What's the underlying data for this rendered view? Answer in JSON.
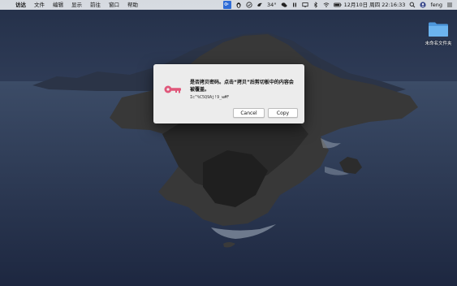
{
  "menubar": {
    "apple_label": "",
    "items": [
      "访达",
      "文件",
      "编辑",
      "显示",
      "前往",
      "窗口",
      "帮助"
    ],
    "status": {
      "temperature": "34°",
      "datetime": "12月10日 周四  22:16:33",
      "user": "feng"
    }
  },
  "desktop": {
    "folder_label": "未命名文件夹"
  },
  "dialog": {
    "message": "是否拷贝密码。点击“拷贝”后剪切板中的内容会被覆盖。",
    "password": "Ic^%C5Q9Aj!9_w#F",
    "cancel_label": "Cancel",
    "copy_label": "Copy"
  },
  "colors": {
    "key_icon": "#e0577a",
    "folder": "#5aa7e8",
    "accent": "#2e6bd6"
  }
}
